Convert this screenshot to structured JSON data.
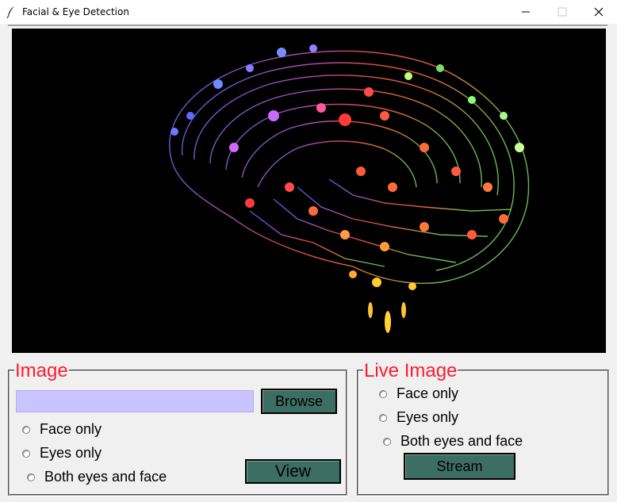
{
  "window": {
    "title": "Facial & Eye Detection"
  },
  "image_group": {
    "label": "Image",
    "path_value": "",
    "browse_label": "Browse",
    "options": [
      "Face only",
      "Eyes only",
      "Both eyes and face"
    ],
    "view_label": "View"
  },
  "live_group": {
    "label": "Live Image",
    "options": [
      "Face only",
      "Eyes only",
      "Both eyes and face"
    ],
    "stream_label": "Stream"
  },
  "colors": {
    "group_label": "#ff1a2e",
    "button_bg": "#3d6e64",
    "input_bg": "#c9c3ff",
    "hero_bg": "#000000"
  },
  "icons": {
    "app": "feather-icon",
    "minimize": "minimize-icon",
    "maximize": "maximize-icon",
    "close": "close-icon"
  }
}
